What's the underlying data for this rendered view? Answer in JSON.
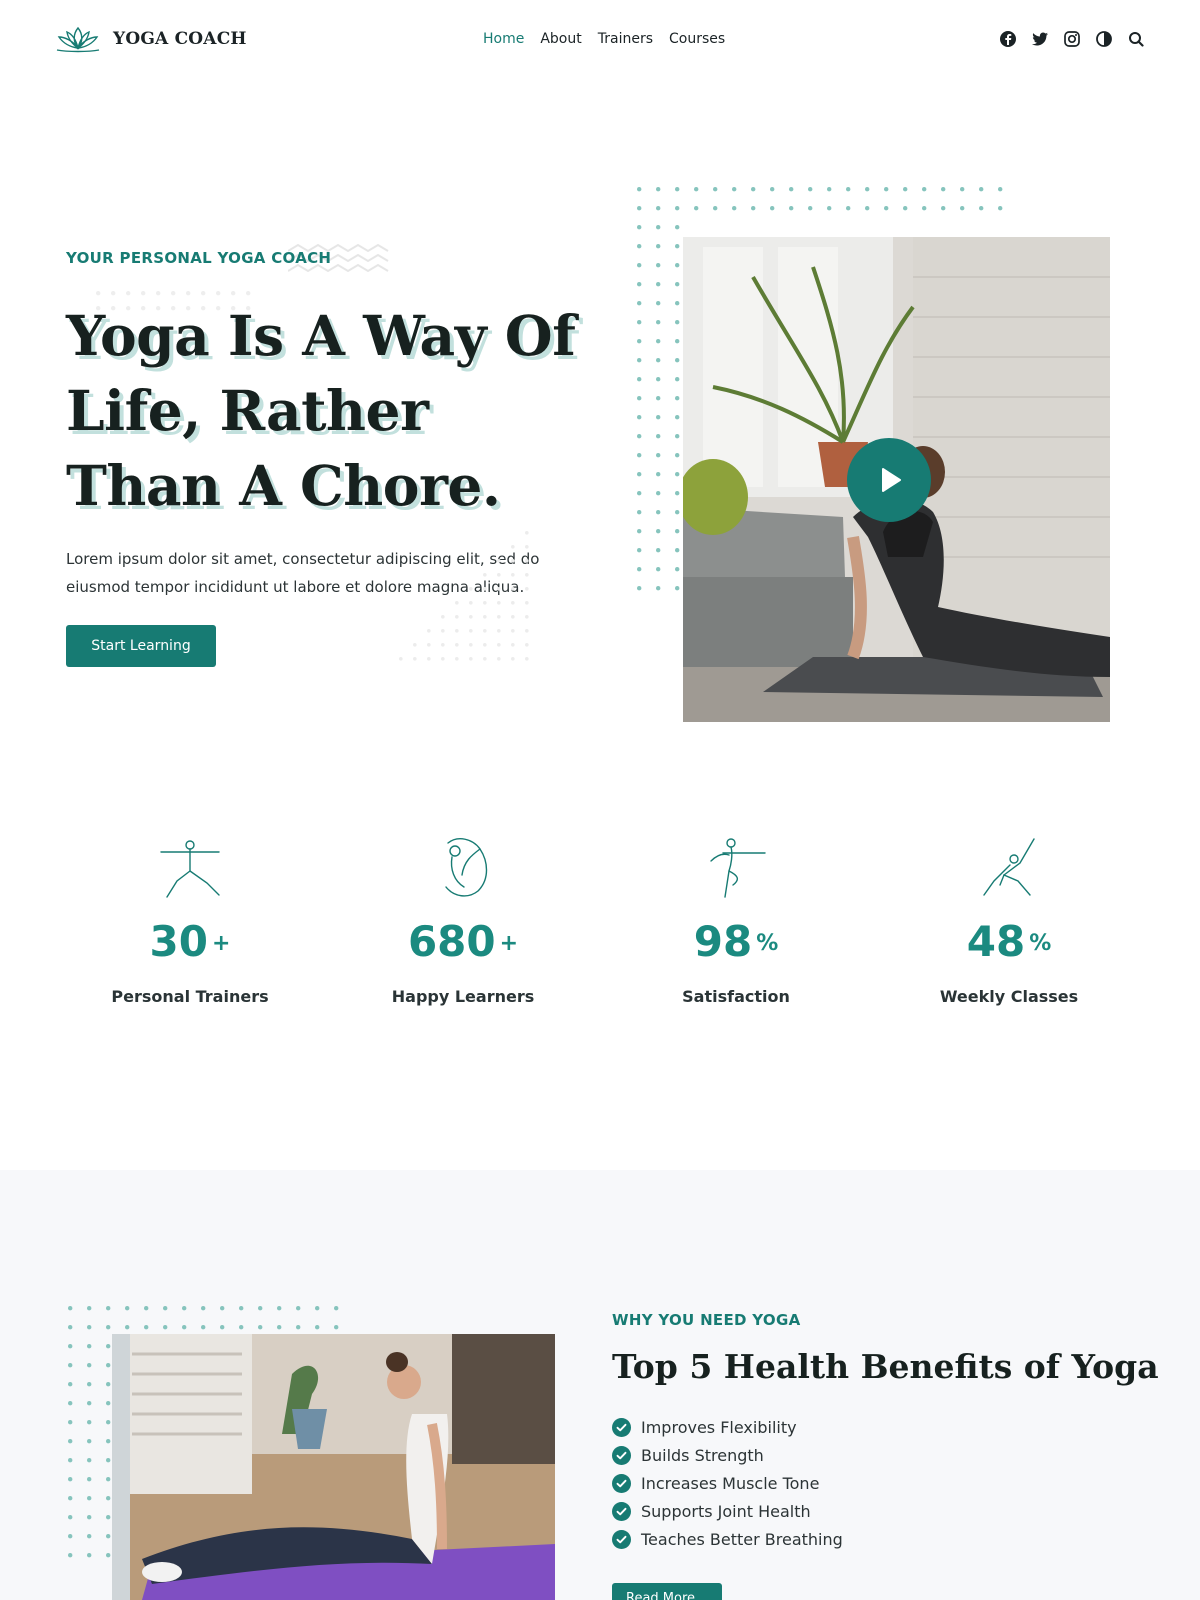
{
  "brand": {
    "name": "YOGA COACH",
    "icon": "lotus-icon",
    "accent": "#177b73"
  },
  "nav": [
    {
      "label": "Home",
      "active": true
    },
    {
      "label": "About",
      "active": false
    },
    {
      "label": "Trainers",
      "active": false
    },
    {
      "label": "Courses",
      "active": false
    }
  ],
  "header_icons": [
    "facebook-icon",
    "twitter-icon",
    "instagram-icon",
    "dark-mode-icon",
    "search-icon"
  ],
  "hero": {
    "eyebrow": "YOUR PERSONAL YOGA COACH",
    "title": "Yoga Is A Way Of Life, Rather Than A Chore.",
    "description": "Lorem ipsum dolor sit amet, consectetur adipiscing elit, sed do eiusmod tempor incididunt ut labore et dolore magna aliqua.",
    "cta": "Start Learning",
    "video_play_icon": "play-icon"
  },
  "stats": [
    {
      "value": "30",
      "suffix": "+",
      "label": "Personal Trainers",
      "icon": "warrior-pose-icon"
    },
    {
      "value": "680",
      "suffix": "+",
      "label": "Happy Learners",
      "icon": "bow-pose-icon"
    },
    {
      "value": "98",
      "suffix": "%",
      "label": "Satisfaction",
      "icon": "standing-pose-icon"
    },
    {
      "value": "48",
      "suffix": "%",
      "label": "Weekly Classes",
      "icon": "triangle-pose-icon"
    }
  ],
  "benefits": {
    "eyebrow": "WHY YOU NEED YOGA",
    "title": "Top 5 Health Benefits of Yoga",
    "items": [
      "Improves Flexibility",
      "Builds Strength",
      "Increases Muscle Tone",
      "Supports Joint Health",
      "Teaches Better Breathing"
    ],
    "cta": "Read More"
  }
}
